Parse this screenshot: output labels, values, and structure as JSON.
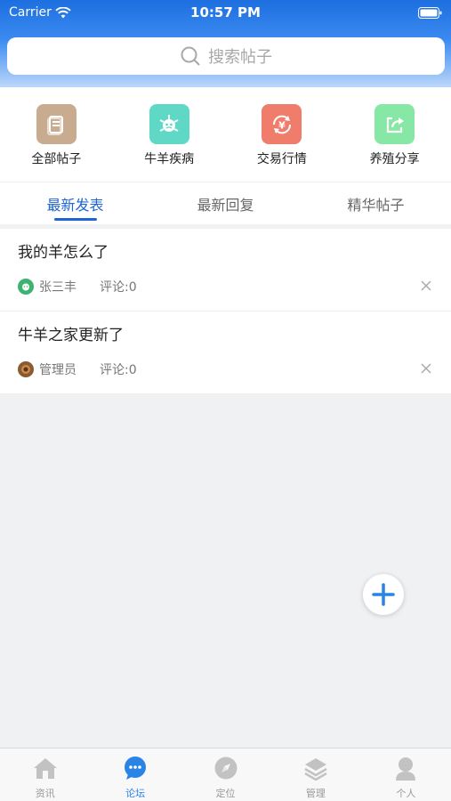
{
  "status_bar": {
    "carrier": "Carrier",
    "time": "10:57 PM"
  },
  "search": {
    "placeholder": "搜索帖子"
  },
  "categories": [
    {
      "label": "全部帖子",
      "icon": "document-icon",
      "color": "#c9ab90"
    },
    {
      "label": "牛羊疾病",
      "icon": "virus-icon",
      "color": "#5fd9c6"
    },
    {
      "label": "交易行情",
      "icon": "yen-exchange-icon",
      "color": "#f07c6c"
    },
    {
      "label": "养殖分享",
      "icon": "share-icon",
      "color": "#87e8a6"
    }
  ],
  "tabs": [
    {
      "label": "最新发表",
      "active": true
    },
    {
      "label": "最新回复",
      "active": false
    },
    {
      "label": "精华帖子",
      "active": false
    }
  ],
  "posts": [
    {
      "title": "我的羊怎么了",
      "author": "张三丰",
      "comments": "评论:0"
    },
    {
      "title": "牛羊之家更新了",
      "author": "管理员",
      "comments": "评论:0"
    }
  ],
  "bottom_nav": [
    {
      "label": "资讯",
      "icon": "home-icon",
      "active": false
    },
    {
      "label": "论坛",
      "icon": "chat-bubble-icon",
      "active": true
    },
    {
      "label": "定位",
      "icon": "compass-icon",
      "active": false
    },
    {
      "label": "管理",
      "icon": "layers-icon",
      "active": false
    },
    {
      "label": "个人",
      "icon": "person-icon",
      "active": false
    }
  ],
  "colors": {
    "accent": "#1e64d4",
    "nav_active": "#2a84e6",
    "nav_inactive": "#c2c2c2"
  }
}
